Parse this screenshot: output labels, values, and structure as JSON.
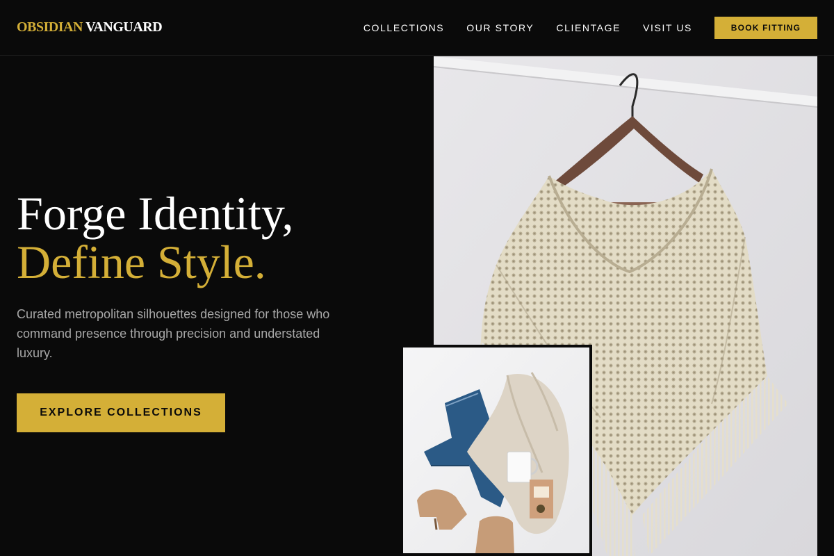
{
  "brand": {
    "part1": "OBSIDIAN",
    "part2": "VANGUARD"
  },
  "nav": {
    "links": [
      "COLLECTIONS",
      "OUR STORY",
      "CLIENTAGE",
      "VISIT US"
    ],
    "cta": "BOOK FITTING"
  },
  "hero": {
    "headline_line1": "Forge Identity,",
    "headline_line2": "Define Style.",
    "subtext": "Curated metropolitan silhouettes designed for those who command presence through precision and understated luxury.",
    "cta": "EXPLORE COLLECTIONS"
  },
  "colors": {
    "background": "#0a0a0a",
    "accent": "#d4af37",
    "text": "#ffffff",
    "muted": "#a8a8a8"
  },
  "images": {
    "main": "knit-poncho-on-hanger-photo",
    "secondary": "flatlay-jeans-sweater-boots-photo"
  }
}
